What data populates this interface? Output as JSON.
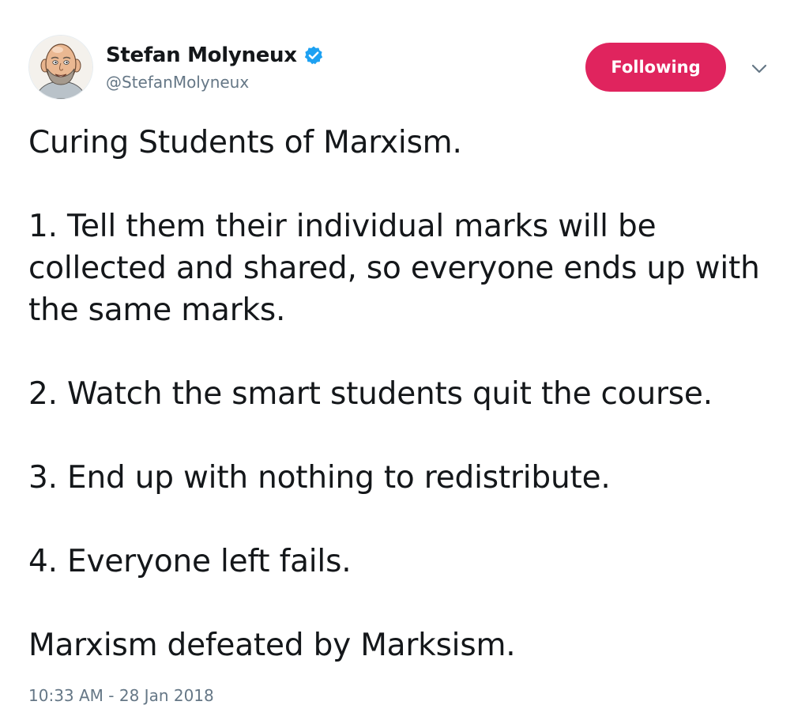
{
  "author": {
    "display_name": "Stefan Molyneux",
    "handle": "@StefanMolyneux",
    "verified": true,
    "avatar_icon": "caricature-avatar-icon"
  },
  "follow_button": {
    "label": "Following",
    "color": "#e0245e"
  },
  "menu_icon": "chevron-down-icon",
  "tweet": {
    "paragraphs": [
      "Curing Students of Marxism.",
      "1. Tell them their individual marks will be collected and shared, so everyone ends up with the same marks.",
      "2. Watch the smart students quit the course.",
      "3. End up with nothing to redistribute.",
      "4. Everyone left fails.",
      "Marxism defeated by Marksism."
    ],
    "timestamp": "10:33 AM - 28 Jan 2018"
  },
  "colors": {
    "text": "#14171a",
    "secondary_text": "#657786",
    "verified_badge": "#1da1f2"
  }
}
